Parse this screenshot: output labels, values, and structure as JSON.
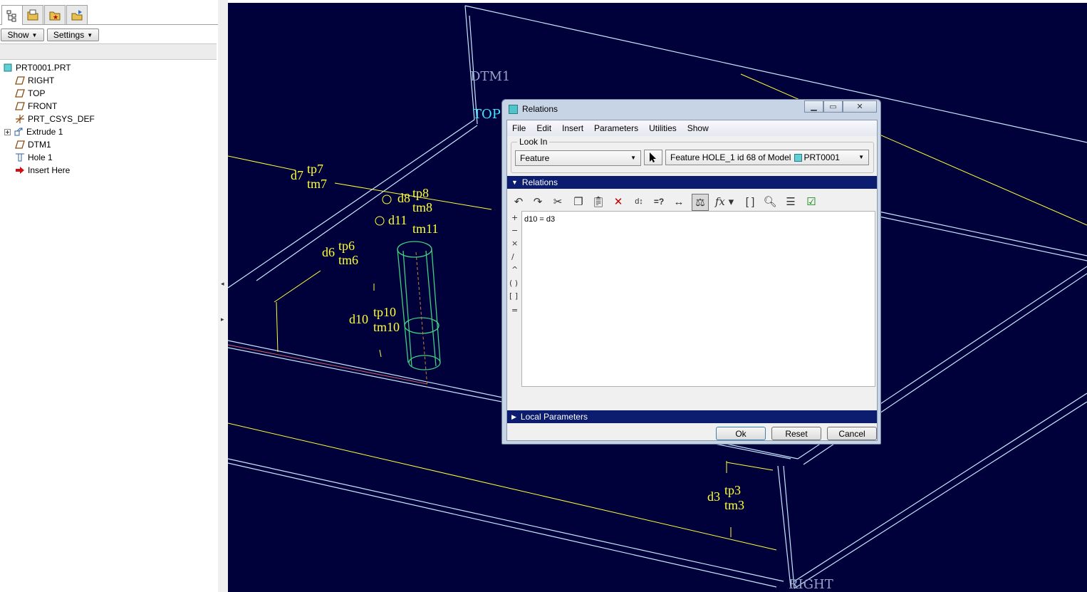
{
  "left_panel": {
    "tabs": [
      {
        "icon": "model-tree-icon"
      },
      {
        "icon": "folder-browser-icon"
      },
      {
        "icon": "favorites-icon"
      },
      {
        "icon": "connections-icon"
      }
    ],
    "show_label": "Show",
    "settings_label": "Settings",
    "tree": [
      {
        "label": "PRT0001.PRT",
        "icon": "part-icon"
      },
      {
        "label": "RIGHT",
        "icon": "datum-plane-icon"
      },
      {
        "label": "TOP",
        "icon": "datum-plane-icon"
      },
      {
        "label": "FRONT",
        "icon": "datum-plane-icon"
      },
      {
        "label": "PRT_CSYS_DEF",
        "icon": "csys-icon"
      },
      {
        "label": "Extrude 1",
        "icon": "extrude-icon"
      },
      {
        "label": "DTM1",
        "icon": "datum-plane-icon"
      },
      {
        "label": "Hole 1",
        "icon": "hole-icon"
      },
      {
        "label": "Insert Here",
        "icon": "insert-arrow-icon"
      }
    ]
  },
  "viewport": {
    "datum_labels": {
      "dtm1": "DTM1",
      "top": "TOP",
      "right": "RIGHT"
    },
    "dims": {
      "d7": "d7",
      "tp7": "tp7",
      "tm7": "tm7",
      "d8": "d8",
      "tp8": "tp8",
      "tm8": "tm8",
      "d11": "d11",
      "tm11": "tm11",
      "d6": "d6",
      "tp6": "tp6",
      "tm6": "tm6",
      "d10": "d10",
      "tp10": "tp10",
      "tm10": "tm10",
      "d3": "d3",
      "tp3": "tp3",
      "tm3": "tm3"
    },
    "colors": {
      "background": "#00003a",
      "edges": "#c8e8ff",
      "dims": "#ffff3a",
      "hole": "#40d080",
      "datum_dtm1": "#9aa4c8",
      "datum_top": "#40e8ff"
    }
  },
  "dialog": {
    "title": "Relations",
    "menus": [
      "File",
      "Edit",
      "Insert",
      "Parameters",
      "Utilities",
      "Show"
    ],
    "look_in_label": "Look In",
    "look_in_value": "Feature",
    "feature_value": "Feature HOLE_1 id 68 of Model",
    "model_name": "PRT0001",
    "relations_header": "Relations",
    "toolbar_icons": [
      "undo-icon",
      "redo-icon",
      "cut-icon",
      "copy-icon",
      "paste-icon",
      "delete-icon",
      "switch-dims-icon",
      "evaluate-icon",
      "insert-dimension-icon",
      "units-icon",
      "function-icon",
      "brackets-icon",
      "verify-icon",
      "sort-icon",
      "check-icon"
    ],
    "operators": [
      "+",
      "−",
      "×",
      "/",
      "^",
      "( )",
      "[ ]",
      "="
    ],
    "relations_text": "d10 = d3",
    "local_params_header": "Local Parameters",
    "ok_label": "Ok",
    "reset_label": "Reset",
    "cancel_label": "Cancel"
  }
}
